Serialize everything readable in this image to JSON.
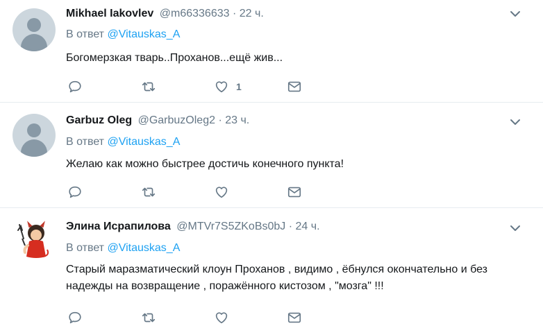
{
  "tweets": [
    {
      "name": "Mikhael Iakovlev",
      "handle": "@m66336633",
      "separator": "·",
      "time": "22 ч.",
      "reply_prefix": "В ответ",
      "reply_to": "@Vitauskas_A",
      "text": "Богомерзкая тварь..Проханов...ещё жив...",
      "like_count": "1",
      "avatar": "default-avatar"
    },
    {
      "name": "Garbuz Oleg",
      "handle": "@GarbuzOleg2",
      "separator": "·",
      "time": "23 ч.",
      "reply_prefix": "В ответ",
      "reply_to": "@Vitauskas_A",
      "text": "Желаю как можно быстрее достичь конечного пункта!",
      "like_count": "",
      "avatar": "default-avatar"
    },
    {
      "name": "Элина Исрапилова",
      "handle": "@MTVr7S5ZKoBs0bJ",
      "separator": "·",
      "time": "24 ч.",
      "reply_prefix": "В ответ",
      "reply_to": "@Vitauskas_A",
      "text": "Старый маразматический клоун Проханов , видимо , ёбнулся окончательно и без надежды на возвращение , поражённого кистозом , \"мозга\" !!!",
      "like_count": "",
      "avatar": "devil-cartoon-avatar"
    }
  ],
  "icons": {
    "reply": "reply-icon",
    "retweet": "retweet-icon",
    "like": "heart-icon",
    "dm": "envelope-icon",
    "menu": "chevron-down-icon"
  },
  "colors": {
    "link": "#1da1f2",
    "secondary_text": "#657786",
    "icon": "#657786",
    "divider": "#e6ecf0"
  }
}
